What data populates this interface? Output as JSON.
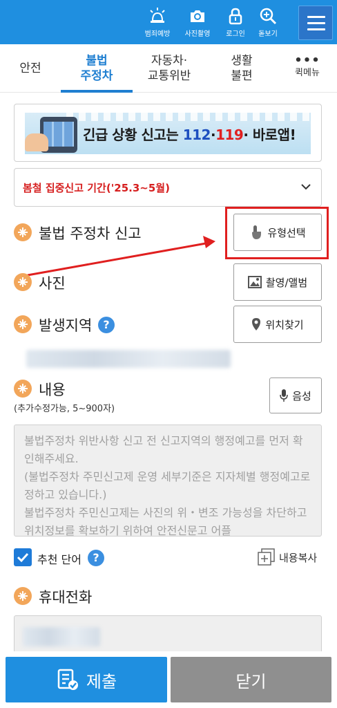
{
  "header": {
    "items": [
      {
        "label": "범죄예방",
        "icon": "siren-icon"
      },
      {
        "label": "사진촬영",
        "icon": "camera-icon"
      },
      {
        "label": "로그인",
        "icon": "lock-icon"
      },
      {
        "label": "돋보기",
        "icon": "magnifier-icon"
      }
    ],
    "menu_icon": "hamburger-icon",
    "color": "#1f8fe0"
  },
  "tabs": [
    {
      "label": "안전",
      "active": false
    },
    {
      "label": "불법\n주정차",
      "active": true
    },
    {
      "label": "자동차·\n교통위반",
      "active": false
    },
    {
      "label": "생활\n불편",
      "active": false
    },
    {
      "label": "퀵메뉴",
      "dots": "•••",
      "active": false
    }
  ],
  "banner": {
    "text_prefix": "긴급 상황 신고는 ",
    "n112": "112",
    "dot1": "·",
    "n119": "119",
    "text_suffix": "· 바로앱!"
  },
  "notice": {
    "text": "봄철 집중신고 기간('25.3~5월)"
  },
  "form": {
    "type_label": "불법 주정차 신고",
    "type_button": "유형선택",
    "photo_label": "사진",
    "photo_button": "촬영/앨범",
    "location_label": "발생지역",
    "location_help": "?",
    "location_button": "위치찾기",
    "content_label": "내용",
    "content_sublabel": "(추가수정가능, 5~900자)",
    "voice_button": "음성",
    "content_placeholder": "불법주정차 위반사항 신고 전 신고지역의 행정예고를 먼저 확인해주세요.\n(불법주정차 주민신고제 운영 세부기준은 지자체별 행정예고로 정하고 있습니다.)\n불법주정차 주민신고제는 사진의 위・변조 가능성을 차단하고 위치정보를 확보하기 위하여 안전신문고 어플",
    "recommend_label": "추천 단어",
    "recommend_help": "?",
    "recommend_checked": true,
    "copy_label": "내용복사",
    "phone_label": "휴대전화"
  },
  "actions": {
    "submit": "제출",
    "close": "닫기"
  },
  "colors": {
    "primary": "#1f8fe0",
    "required": "#f2a65a",
    "alert": "#d61f1f",
    "highlight": "#e01f1f",
    "close": "#8f8f8f"
  }
}
